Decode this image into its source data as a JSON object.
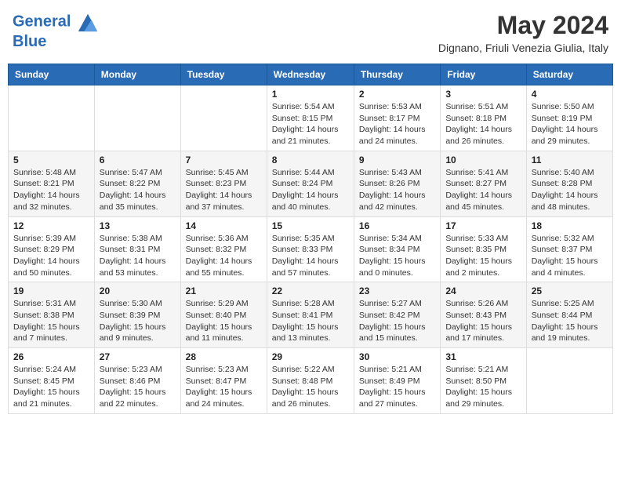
{
  "header": {
    "logo_line1": "General",
    "logo_line2": "Blue",
    "month_title": "May 2024",
    "location": "Dignano, Friuli Venezia Giulia, Italy"
  },
  "days_of_week": [
    "Sunday",
    "Monday",
    "Tuesday",
    "Wednesday",
    "Thursday",
    "Friday",
    "Saturday"
  ],
  "weeks": [
    [
      {
        "day": "",
        "info": ""
      },
      {
        "day": "",
        "info": ""
      },
      {
        "day": "",
        "info": ""
      },
      {
        "day": "1",
        "info": "Sunrise: 5:54 AM\nSunset: 8:15 PM\nDaylight: 14 hours and 21 minutes."
      },
      {
        "day": "2",
        "info": "Sunrise: 5:53 AM\nSunset: 8:17 PM\nDaylight: 14 hours and 24 minutes."
      },
      {
        "day": "3",
        "info": "Sunrise: 5:51 AM\nSunset: 8:18 PM\nDaylight: 14 hours and 26 minutes."
      },
      {
        "day": "4",
        "info": "Sunrise: 5:50 AM\nSunset: 8:19 PM\nDaylight: 14 hours and 29 minutes."
      }
    ],
    [
      {
        "day": "5",
        "info": "Sunrise: 5:48 AM\nSunset: 8:21 PM\nDaylight: 14 hours and 32 minutes."
      },
      {
        "day": "6",
        "info": "Sunrise: 5:47 AM\nSunset: 8:22 PM\nDaylight: 14 hours and 35 minutes."
      },
      {
        "day": "7",
        "info": "Sunrise: 5:45 AM\nSunset: 8:23 PM\nDaylight: 14 hours and 37 minutes."
      },
      {
        "day": "8",
        "info": "Sunrise: 5:44 AM\nSunset: 8:24 PM\nDaylight: 14 hours and 40 minutes."
      },
      {
        "day": "9",
        "info": "Sunrise: 5:43 AM\nSunset: 8:26 PM\nDaylight: 14 hours and 42 minutes."
      },
      {
        "day": "10",
        "info": "Sunrise: 5:41 AM\nSunset: 8:27 PM\nDaylight: 14 hours and 45 minutes."
      },
      {
        "day": "11",
        "info": "Sunrise: 5:40 AM\nSunset: 8:28 PM\nDaylight: 14 hours and 48 minutes."
      }
    ],
    [
      {
        "day": "12",
        "info": "Sunrise: 5:39 AM\nSunset: 8:29 PM\nDaylight: 14 hours and 50 minutes."
      },
      {
        "day": "13",
        "info": "Sunrise: 5:38 AM\nSunset: 8:31 PM\nDaylight: 14 hours and 53 minutes."
      },
      {
        "day": "14",
        "info": "Sunrise: 5:36 AM\nSunset: 8:32 PM\nDaylight: 14 hours and 55 minutes."
      },
      {
        "day": "15",
        "info": "Sunrise: 5:35 AM\nSunset: 8:33 PM\nDaylight: 14 hours and 57 minutes."
      },
      {
        "day": "16",
        "info": "Sunrise: 5:34 AM\nSunset: 8:34 PM\nDaylight: 15 hours and 0 minutes."
      },
      {
        "day": "17",
        "info": "Sunrise: 5:33 AM\nSunset: 8:35 PM\nDaylight: 15 hours and 2 minutes."
      },
      {
        "day": "18",
        "info": "Sunrise: 5:32 AM\nSunset: 8:37 PM\nDaylight: 15 hours and 4 minutes."
      }
    ],
    [
      {
        "day": "19",
        "info": "Sunrise: 5:31 AM\nSunset: 8:38 PM\nDaylight: 15 hours and 7 minutes."
      },
      {
        "day": "20",
        "info": "Sunrise: 5:30 AM\nSunset: 8:39 PM\nDaylight: 15 hours and 9 minutes."
      },
      {
        "day": "21",
        "info": "Sunrise: 5:29 AM\nSunset: 8:40 PM\nDaylight: 15 hours and 11 minutes."
      },
      {
        "day": "22",
        "info": "Sunrise: 5:28 AM\nSunset: 8:41 PM\nDaylight: 15 hours and 13 minutes."
      },
      {
        "day": "23",
        "info": "Sunrise: 5:27 AM\nSunset: 8:42 PM\nDaylight: 15 hours and 15 minutes."
      },
      {
        "day": "24",
        "info": "Sunrise: 5:26 AM\nSunset: 8:43 PM\nDaylight: 15 hours and 17 minutes."
      },
      {
        "day": "25",
        "info": "Sunrise: 5:25 AM\nSunset: 8:44 PM\nDaylight: 15 hours and 19 minutes."
      }
    ],
    [
      {
        "day": "26",
        "info": "Sunrise: 5:24 AM\nSunset: 8:45 PM\nDaylight: 15 hours and 21 minutes."
      },
      {
        "day": "27",
        "info": "Sunrise: 5:23 AM\nSunset: 8:46 PM\nDaylight: 15 hours and 22 minutes."
      },
      {
        "day": "28",
        "info": "Sunrise: 5:23 AM\nSunset: 8:47 PM\nDaylight: 15 hours and 24 minutes."
      },
      {
        "day": "29",
        "info": "Sunrise: 5:22 AM\nSunset: 8:48 PM\nDaylight: 15 hours and 26 minutes."
      },
      {
        "day": "30",
        "info": "Sunrise: 5:21 AM\nSunset: 8:49 PM\nDaylight: 15 hours and 27 minutes."
      },
      {
        "day": "31",
        "info": "Sunrise: 5:21 AM\nSunset: 8:50 PM\nDaylight: 15 hours and 29 minutes."
      },
      {
        "day": "",
        "info": ""
      }
    ]
  ]
}
